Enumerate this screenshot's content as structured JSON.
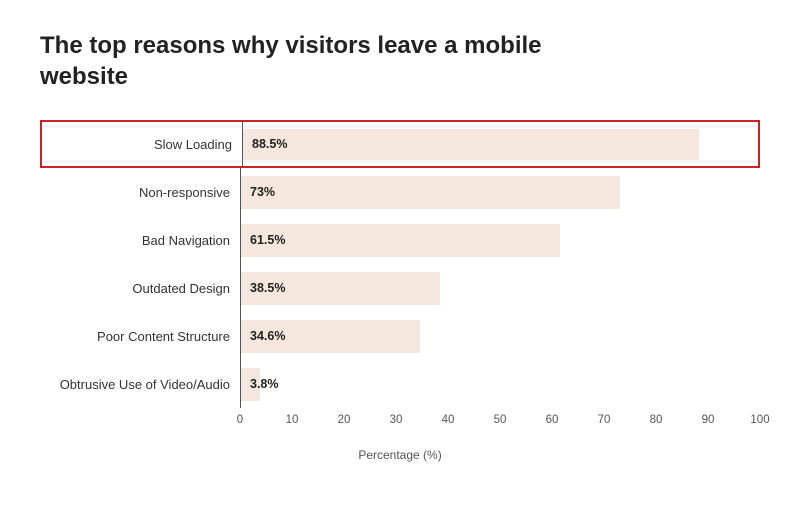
{
  "title": "The top reasons why visitors leave a mobile website",
  "bars": [
    {
      "label": "Slow Loading",
      "value": 88.5,
      "valueLabel": "88.5%",
      "highlighted": true
    },
    {
      "label": "Non-responsive",
      "value": 73,
      "valueLabel": "73%",
      "highlighted": false
    },
    {
      "label": "Bad Navigation",
      "value": 61.5,
      "valueLabel": "61.5%",
      "highlighted": false
    },
    {
      "label": "Outdated Design",
      "value": 38.5,
      "valueLabel": "38.5%",
      "highlighted": false
    },
    {
      "label": "Poor Content Structure",
      "value": 34.6,
      "valueLabel": "34.6%",
      "highlighted": false
    },
    {
      "label": "Obtrusive Use of Video/Audio",
      "value": 3.8,
      "valueLabel": "3.8%",
      "highlighted": false
    }
  ],
  "xAxis": {
    "ticks": [
      0,
      10,
      20,
      30,
      40,
      50,
      60,
      70,
      80,
      90,
      100
    ],
    "title": "Percentage (%)"
  }
}
